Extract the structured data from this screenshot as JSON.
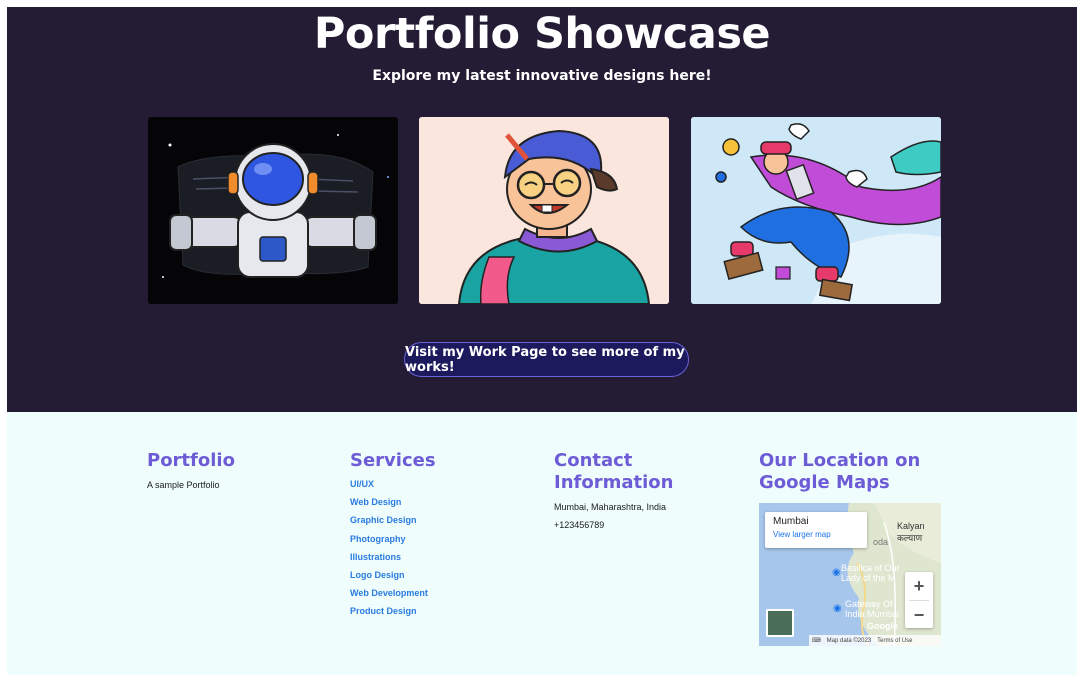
{
  "hero": {
    "title": "Portfolio Showcase",
    "subtitle": "Explore my latest innovative designs here!",
    "cta_label": "Visit my Work Page to see more of my works!"
  },
  "footer": {
    "portfolio": {
      "heading": "Portfolio",
      "text": "A sample Portfolio"
    },
    "services": {
      "heading": "Services",
      "items": [
        "UI/UX",
        "Web Design",
        "Graphic Design",
        "Photography",
        "Illustrations",
        "Logo Design",
        "Web Development",
        "Product Design"
      ]
    },
    "contact": {
      "heading": "Contact Information",
      "address": "Mumbai, Maharashtra, India",
      "phone": "+123456789"
    },
    "location": {
      "heading": "Our Location on Google Maps",
      "map": {
        "place_name": "Mumbai",
        "larger_map_link": "View larger map",
        "label_kalyan": "Kalyan",
        "label_kalyan_local": "कल्याण",
        "label_basilica": "Basilica of Our Lady of the M",
        "label_gateway": "Gateway Of India Mumbai",
        "label_oda": "oda",
        "zoom_in": "+",
        "zoom_out": "−",
        "google_logo": "Google",
        "map_data": "Map data ©2023",
        "terms": "Terms of Use"
      }
    }
  },
  "colors": {
    "hero_bg": "#241c35",
    "footer_bg": "#effefd",
    "heading_accent": "#6e5bd6",
    "link": "#2a7be0",
    "cta_bg": "#1c1a5c",
    "cta_border": "#6b62d9"
  },
  "icons": {
    "keyboard": "keyboard-icon",
    "map_pin": "map-pin-icon"
  }
}
